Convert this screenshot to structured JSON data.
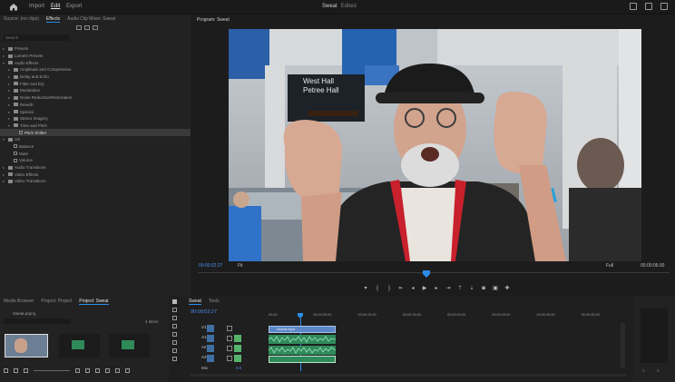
{
  "topbar": {
    "workspaces": [
      "Import",
      "Edit",
      "Export"
    ],
    "project_title": "Sweat",
    "project_subtitle": "Edited"
  },
  "effects_panel": {
    "tabs": [
      "Source: (no clips)",
      "Effects",
      "Audio Clip Mixer: Sweat"
    ],
    "search_placeholder": "Search",
    "items": [
      {
        "label": "Presets",
        "indent": 0,
        "kind": "folder",
        "open": false
      },
      {
        "label": "Lumetri Presets",
        "indent": 0,
        "kind": "folder",
        "open": false
      },
      {
        "label": "Audio Effects",
        "indent": 0,
        "kind": "folder",
        "open": true
      },
      {
        "label": "Amplitude and Compression",
        "indent": 1,
        "kind": "folder",
        "open": false
      },
      {
        "label": "Delay and Echo",
        "indent": 1,
        "kind": "folder",
        "open": false
      },
      {
        "label": "Filter and EQ",
        "indent": 1,
        "kind": "folder",
        "open": false
      },
      {
        "label": "Modulation",
        "indent": 1,
        "kind": "folder",
        "open": false
      },
      {
        "label": "Noise Reduction/Restoration",
        "indent": 1,
        "kind": "folder",
        "open": false
      },
      {
        "label": "Reverb",
        "indent": 1,
        "kind": "folder",
        "open": false
      },
      {
        "label": "Special",
        "indent": 1,
        "kind": "folder",
        "open": false
      },
      {
        "label": "Stereo Imagery",
        "indent": 1,
        "kind": "folder",
        "open": false
      },
      {
        "label": "Time and Pitch",
        "indent": 1,
        "kind": "folder",
        "open": true
      },
      {
        "label": "Pitch Shifter",
        "indent": 2,
        "kind": "effect",
        "selected": true
      },
      {
        "label": "Vol",
        "indent": 0,
        "kind": "folder",
        "open": true
      },
      {
        "label": "Balance",
        "indent": 1,
        "kind": "effect"
      },
      {
        "label": "Mute",
        "indent": 1,
        "kind": "effect"
      },
      {
        "label": "Volume",
        "indent": 1,
        "kind": "effect"
      },
      {
        "label": "Audio Transitions",
        "indent": 0,
        "kind": "folder",
        "open": false
      },
      {
        "label": "Video Effects",
        "indent": 0,
        "kind": "folder",
        "open": false
      },
      {
        "label": "Video Transitions",
        "indent": 0,
        "kind": "folder",
        "open": false
      }
    ]
  },
  "program": {
    "header": "Program: Sweat",
    "timecode_left": "00:00:02:27",
    "fit": "Fit",
    "quality": "Full",
    "timecode_right": "00:00:06:00",
    "sign_line1": "West Hall",
    "sign_line2": "Petree Hall"
  },
  "project_panel": {
    "tabs": [
      "Media Browser",
      "Project: Project",
      "Project: Sweat"
    ],
    "bin": "Sweat.prproj",
    "count": "4 items"
  },
  "timeline": {
    "tab": "Sweat",
    "tab2": "Tools",
    "timecode": "00:00:02:27",
    "ruler": [
      "00:00",
      "00:00:05:00",
      "00:00:10:00",
      "00:00:15:00",
      "00:00:20:00",
      "00:00:25:00",
      "00:00:30:00",
      "00:00:35:00"
    ],
    "tracks": [
      "V1",
      "A1",
      "A2",
      "A3"
    ],
    "clip_name": "Sweat.mp4",
    "mix": "Mix",
    "mix_value": "0.0"
  },
  "colors": {
    "accent": "#2d8ceb",
    "timecode": "#4b8ff2",
    "audio_clip": "#2f8a5a",
    "video_clip": "#5b87c7"
  }
}
